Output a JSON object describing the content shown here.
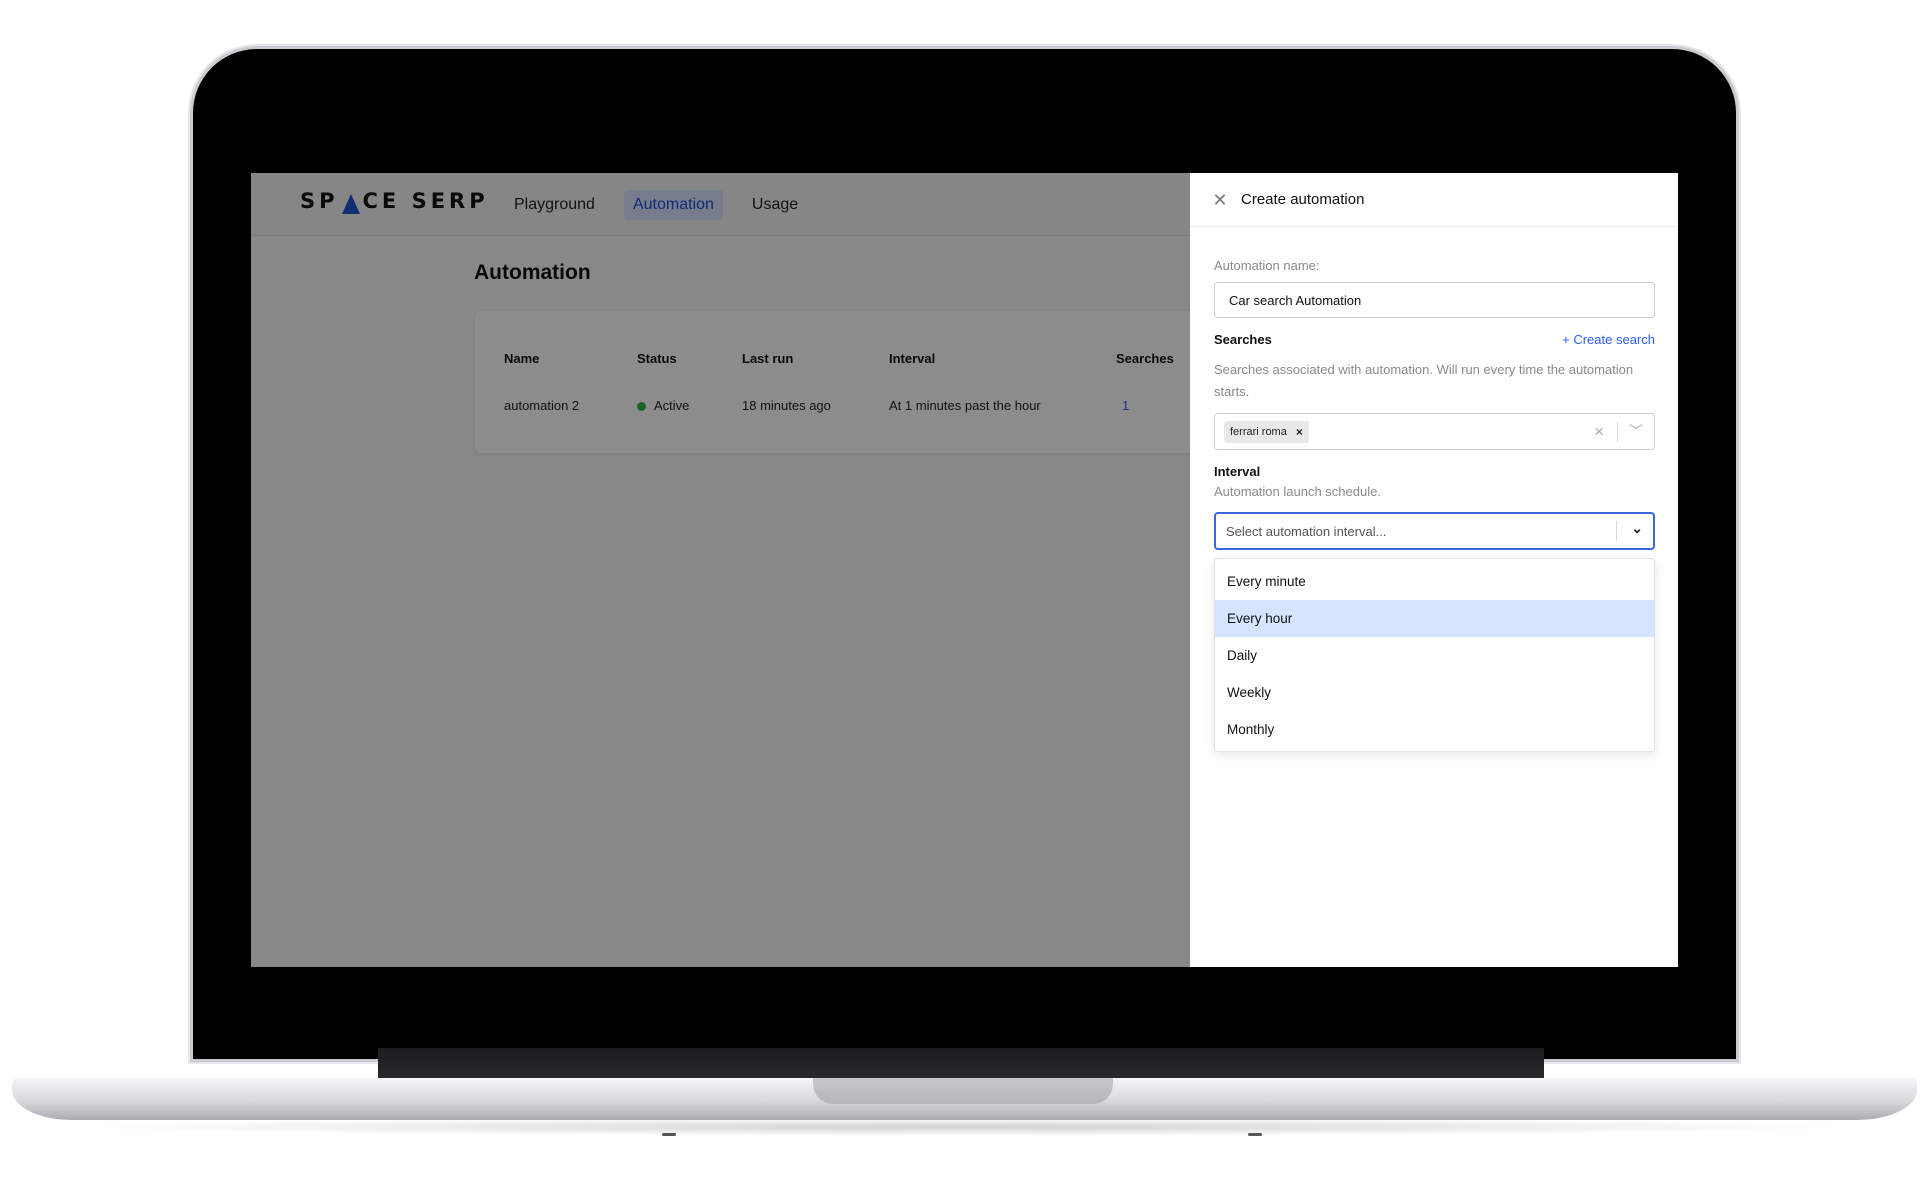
{
  "app": {
    "logo": {
      "left": "SP",
      "right": "CE SERP"
    },
    "nav": [
      {
        "label": "Playground",
        "active": false
      },
      {
        "label": "Automation",
        "active": true
      },
      {
        "label": "Usage",
        "active": false
      }
    ],
    "page_title": "Automation",
    "table": {
      "headers": [
        "Name",
        "Status",
        "Last run",
        "Interval",
        "Searches"
      ],
      "rows": [
        {
          "name": "automation 2",
          "status": "Active",
          "last_run": "18 minutes ago",
          "interval": "At 1 minutes past the hour",
          "searches": "1"
        }
      ]
    }
  },
  "drawer": {
    "title": "Create automation",
    "name_label": "Automation name:",
    "name_value": "Car search Automation",
    "searches_label": "Searches",
    "create_search": "+ Create search",
    "searches_desc": "Searches associated with automation. Will run every time the automation starts.",
    "selected_search": "ferrari roma",
    "interval_label": "Interval",
    "interval_desc": "Automation launch schedule.",
    "interval_placeholder": "Select automation interval...",
    "interval_options": [
      "Every minute",
      "Every hour",
      "Daily",
      "Weekly",
      "Monthly"
    ],
    "highlighted_option": "Every hour"
  },
  "colors": {
    "accent": "#2b5cff",
    "status_active": "#2fb344",
    "highlight": "#d6e4ff"
  },
  "icons": {
    "close": "close-icon",
    "chip_remove": "chip-remove-icon",
    "clear": "clear-icon",
    "dropdown": "chevron-down-icon"
  }
}
